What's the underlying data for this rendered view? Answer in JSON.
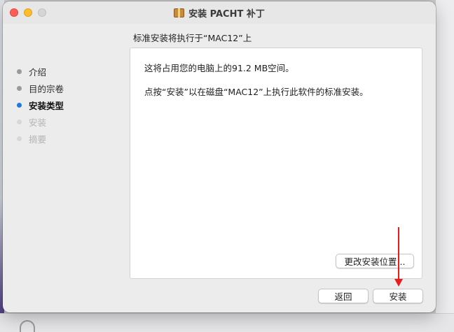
{
  "window": {
    "title": "安装 PACHT 补丁",
    "subtitle": "标准安装将执行于“MAC12”上"
  },
  "steps": [
    {
      "label": "介绍",
      "state": "done"
    },
    {
      "label": "目的宗卷",
      "state": "done"
    },
    {
      "label": "安装类型",
      "state": "current"
    },
    {
      "label": "安装",
      "state": "future"
    },
    {
      "label": "摘要",
      "state": "future"
    }
  ],
  "content": {
    "line1": "这将占用您的电脑上的91.2 MB空间。",
    "line2": "点按“安装”以在磁盘“MAC12”上执行此软件的标准安装。",
    "change_location_label": "更改安装位置..."
  },
  "footer": {
    "back_label": "返回",
    "install_label": "安装"
  },
  "colors": {
    "accent": "#1f7ae0",
    "annotation_arrow": "#e81c1c",
    "close": "#ff5f57",
    "minimize": "#febc2e"
  }
}
